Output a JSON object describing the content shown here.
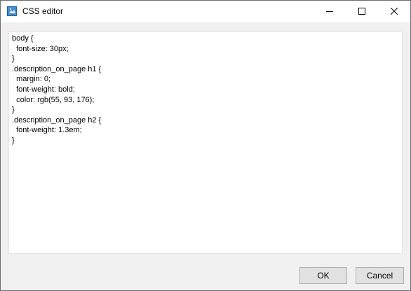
{
  "window": {
    "title": "CSS editor",
    "icon": "css-editor-app-icon"
  },
  "title_controls": {
    "minimize": "minimize-icon",
    "maximize": "maximize-icon",
    "close": "close-icon"
  },
  "editor": {
    "content": "body {\n  font-size: 30px;\n}\n.description_on_page h1 {\n  margin: 0;\n  font-weight: bold;\n  color: rgb(55, 93, 176);\n}\n.description_on_page h2 {\n  font-weight: 1.3em;\n}"
  },
  "buttons": {
    "ok": "OK",
    "cancel": "Cancel"
  }
}
